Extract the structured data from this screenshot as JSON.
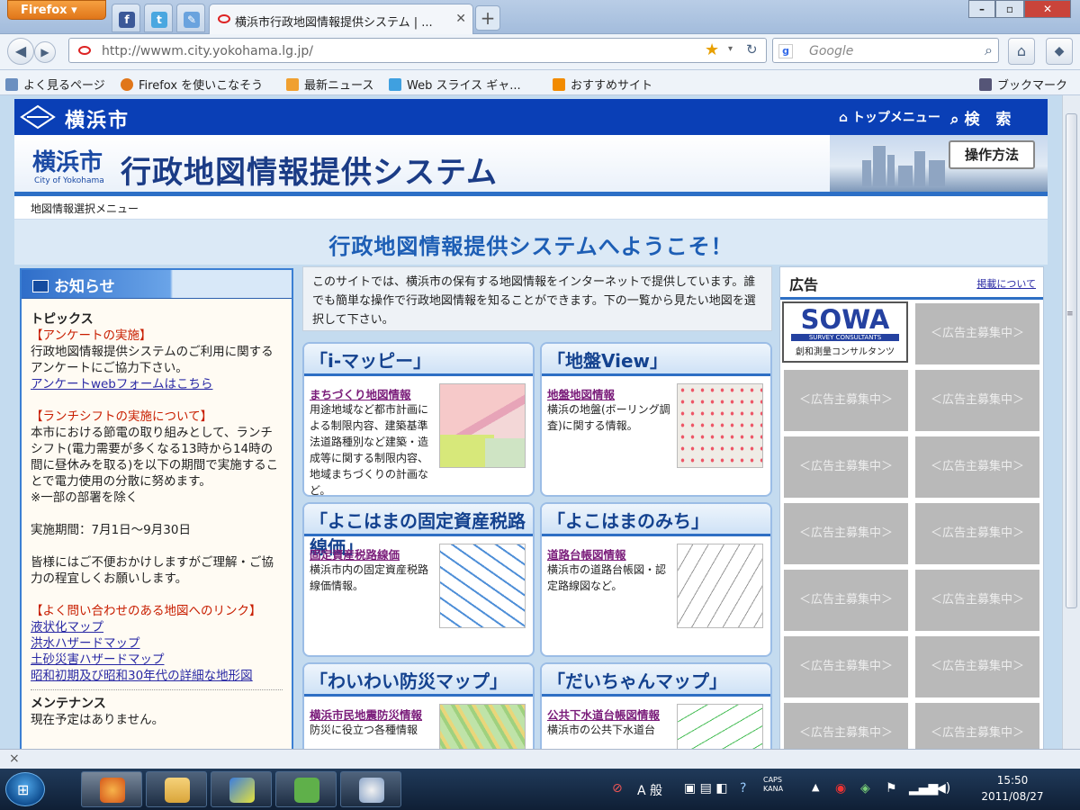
{
  "browser": {
    "app_button": "Firefox",
    "tab_title": "横浜市行政地図情報提供システム | ...",
    "url": "http://wwwm.city.yokohama.lg.jp/",
    "search_placeholder": "Google",
    "bookmarks": [
      "よく見るページ",
      "Firefox を使いこなそう",
      "最新ニュース",
      "Web スライス ギャ...",
      "おすすめサイト"
    ],
    "bookmark_menu": "ブックマーク",
    "status_close": "×"
  },
  "header": {
    "city": "横浜市",
    "top_menu": "トップメニュー",
    "search": "検 索"
  },
  "banner": {
    "city": "横浜市",
    "city_en": "City of Yokohama",
    "system": "行政地図情報提供システム",
    "howto": "操作方法"
  },
  "breadcrumb": "地図情報選択メニュー",
  "welcome": "行政地図情報提供システムへようこそ！",
  "notice": {
    "title": "お知らせ",
    "topics": "トピックス",
    "s1_title": "【アンケートの実施】",
    "s1_text": "行政地図情報提供システムのご利用に関するアンケートにご協力下さい。",
    "s1_link": "アンケートwebフォームはこちら",
    "s2_title": "【ランチシフトの実施について】",
    "s2_text": "本市における節電の取り組みとして、ランチシフト(電力需要が多くなる13時から14時の間に昼休みを取る)を以下の期間で実施することで電力使用の分散に努めます。",
    "s2_note": "※一部の部署を除く",
    "s2_period": "実施期間：7月1日～9月30日",
    "s2_apology": "皆様にはご不便おかけしますがご理解・ご協力の程宜しくお願いします。",
    "s3_title": "【よく問い合わせのある地図へのリンク】",
    "links": [
      "液状化マップ",
      "洪水ハザードマップ",
      "土砂災害ハザードマップ",
      "昭和初期及び昭和30年代の詳細な地形図"
    ],
    "maint_title": "メンテナンス",
    "maint_text": "現在予定はありません。"
  },
  "intro": "このサイトでは、横浜市の保有する地図情報をインターネットで提供しています。誰でも簡単な操作で行政地図情報を知ることができます。下の一覧から見たい地図を選択して下さい。",
  "cards": [
    {
      "title": "「i-マッピー」",
      "link": "まちづくり地図情報",
      "desc": "用途地域など都市計画による制限内容、建築基準法道路種別など建築・造成等に関する制限内容、地域まちづくりの計画など。"
    },
    {
      "title": "「地盤View」",
      "link": "地盤地図情報",
      "desc": "横浜の地盤(ボーリング調査)に関する情報。"
    },
    {
      "title": "「よこはまの固定資産税路線価」",
      "link": "固定資産税路線価",
      "desc": "横浜市内の固定資産税路線価情報。"
    },
    {
      "title": "「よこはまのみち」",
      "link": "道路台帳図情報",
      "desc": "横浜市の道路台帳図・認定路線図など。"
    },
    {
      "title": "「わいわい防災マップ」",
      "link": "横浜市民地震防災情報",
      "desc": "防災に役立つ各種情報"
    },
    {
      "title": "「だいちゃんマップ」",
      "link": "公共下水道台帳図情報",
      "desc": "横浜市の公共下水道台"
    }
  ],
  "ads": {
    "title": "広告",
    "about": "掲載について",
    "sowa": "SOWA",
    "sowa_sub": "SURVEY CONSULTANTS",
    "sowa_jp": "創和測量コンサルタンツ",
    "slot": "＜広告主募集中＞"
  },
  "taskbar": {
    "time": "15:50",
    "date": "2011/08/27",
    "ime": "A 般",
    "caps": "CAPS KANA"
  },
  "colors": {
    "header_blue": "#0a3fb6",
    "accent": "#2e6fc4",
    "firefox_orange": "#e0761a",
    "notice_red": "#c81e00"
  }
}
